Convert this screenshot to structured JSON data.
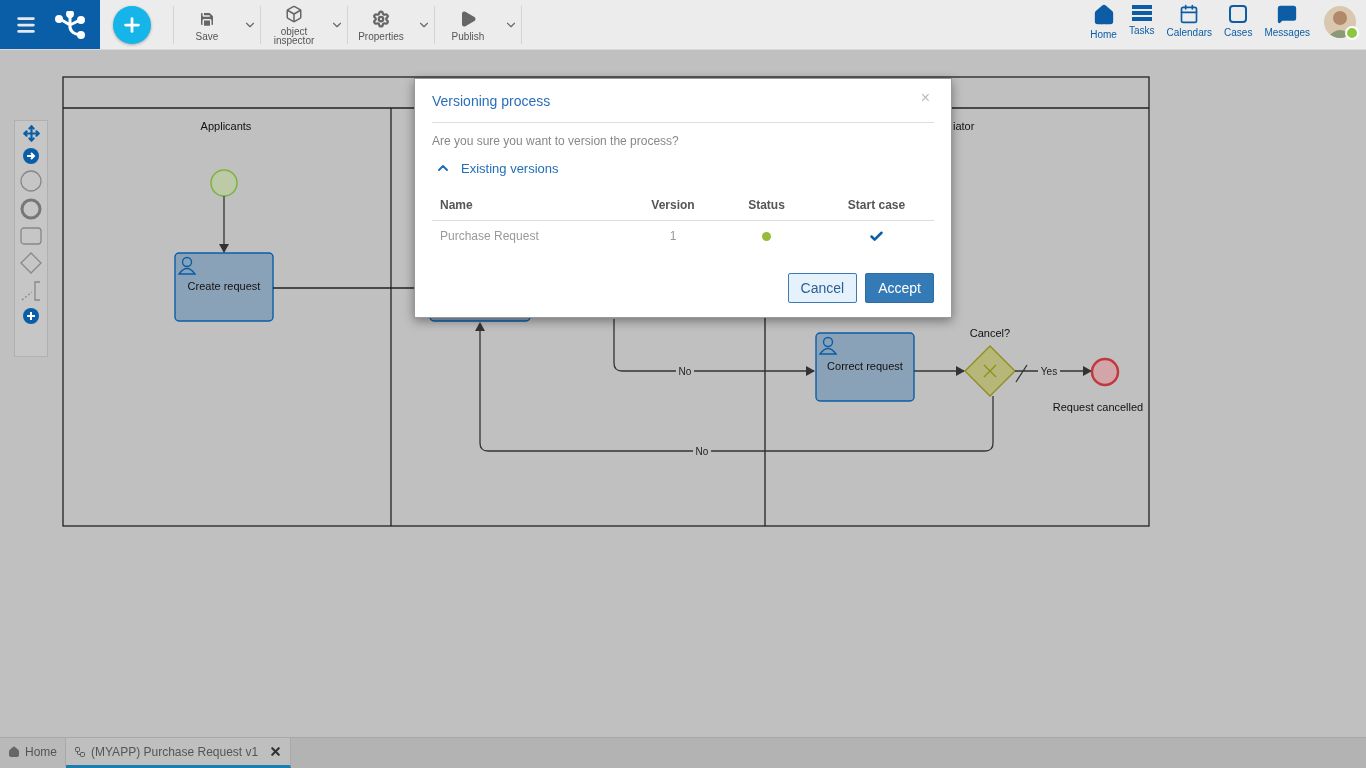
{
  "toolbar": {
    "items": [
      {
        "label": "Save",
        "kind": "save"
      },
      {
        "label": "object inspector",
        "kind": "cube"
      },
      {
        "label": "Properties",
        "kind": "gear"
      },
      {
        "label": "Publish",
        "kind": "play"
      }
    ]
  },
  "nav": [
    {
      "label": "Home",
      "kind": "home"
    },
    {
      "label": "Tasks",
      "kind": "tasks"
    },
    {
      "label": "Calendars",
      "kind": "calendar"
    },
    {
      "label": "Cases",
      "kind": "cases"
    },
    {
      "label": "Messages",
      "kind": "messages"
    }
  ],
  "user": {
    "online": true
  },
  "diagram": {
    "lane_labels": [
      "Applicants",
      "iator"
    ],
    "tasks": [
      {
        "label": "Create request"
      },
      {
        "label": "Correct request"
      }
    ],
    "gateway": {
      "label": "Cancel?"
    },
    "end_event": {
      "label": "Request cancelled"
    },
    "flow_labels": [
      "No",
      "Yes",
      "No"
    ]
  },
  "dialog": {
    "title": "Versioning process",
    "close": "×",
    "question": "Are you sure you want to version the process?",
    "section": {
      "label": "Existing versions",
      "expanded": true
    },
    "columns": [
      "Name",
      "Version",
      "Status",
      "Start case"
    ],
    "rows": [
      {
        "name": "Purchase Request",
        "version": "1",
        "color": "#99bb3c",
        "start_case": true
      }
    ],
    "buttons": [
      {
        "label": "Cancel",
        "kind": "secondary"
      },
      {
        "label": "Accept",
        "kind": "primary"
      }
    ]
  },
  "tabs": [
    {
      "label": "Home",
      "kind": "home",
      "selected": false,
      "closable": false
    },
    {
      "label": "(MYAPP) Purchase Request v1",
      "kind": "process",
      "selected": true,
      "closable": true
    }
  ]
}
